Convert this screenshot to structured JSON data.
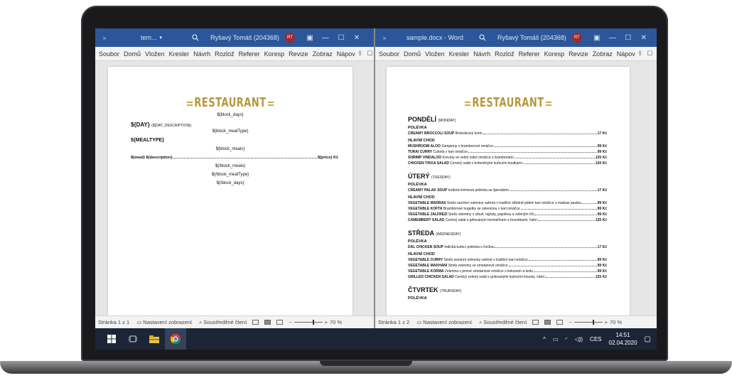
{
  "left": {
    "title": "tem...",
    "user": "Ryšavý Tomáš (204368)",
    "initials": "RT",
    "tabs": [
      "Soubor",
      "Domů",
      "Vložen",
      "Kresler",
      "Návrh",
      "Rozlož",
      "Referer",
      "Koresp",
      "Revize",
      "Zobraz",
      "Nápov"
    ],
    "logo": "RESTAURANT",
    "template": {
      "block_days": "${block_days}",
      "day": "${DAY}",
      "day_desc": "(${DAY_DESCRIPTION})",
      "block_mealtype": "${block_mealType}",
      "mealtype": "${MEALTYPE}",
      "block_meals": "${block_meals}",
      "meal_left": "${meal} ${description}",
      "meal_price": "${price} Kč",
      "end_meals": "${/block_meals}",
      "end_mealtype": "${/block_mealType}",
      "end_days": "${/block_days}"
    },
    "status": {
      "page": "Stránka 1 z 1",
      "view_settings": "Nastavení zobrazení",
      "focus": "Soustředěné čtení",
      "zoom": "70 %"
    }
  },
  "right": {
    "title": "sample.docx - Word",
    "user": "Ryšavý Tomáš (204368)",
    "initials": "RT",
    "tabs": [
      "Soubor",
      "Domů",
      "Vložen",
      "Kresler",
      "Návrh",
      "Rozlož",
      "Referer",
      "Koresp",
      "Revize",
      "Zobraz",
      "Nápov"
    ],
    "logo": "RESTAURANT",
    "days": [
      {
        "name": "PONDĚLÍ",
        "desc": "(MONDAY)",
        "sections": [
          {
            "title": "POLÉVKA",
            "rows": [
              {
                "name": "CREAMY BROCCOLI SOUP",
                "desc": "Brokolicový krém",
                "price": "17 Kč"
              }
            ]
          },
          {
            "title": "HLAVNÍ CHOD",
            "rows": [
              {
                "name": "MUSHROOM ALOO",
                "desc": "Žampiony v bramborové omáčce",
                "price": "99 Kč"
              },
              {
                "name": "TURAI CURRY",
                "desc": "Cuketa v kari omáčce",
                "price": "99 Kč"
              },
              {
                "name": "SHRIMP VINDALOO",
                "desc": "Krevety ve velmi ostré omáčce s bramborami",
                "price": "125 Kč"
              },
              {
                "name": "CHICKEN TIKKA SALAD",
                "desc": "Čerstvý salát s kořeněnými kuřecími kostkami",
                "price": "120 Kč"
              }
            ]
          }
        ]
      },
      {
        "name": "ÚTERÝ",
        "desc": "(TUESDAY)",
        "sections": [
          {
            "title": "POLÉVKA",
            "rows": [
              {
                "name": "CREAMY PALAK SOUP",
                "desc": "Indická krémová polévka se špenátem",
                "price": "17 Kč"
              }
            ]
          },
          {
            "title": "HLAVNÍ CHOD",
            "rows": [
              {
                "name": "VEGETABLE MADRAS",
                "desc": "Směs sezónní zeleniny vařená v tradiční středně pálivé kari omáčce s madras pastou",
                "price": "99 Kč"
              },
              {
                "name": "VEGETABLE KOFTA",
                "desc": "Bramborové nugetky se zeleninou v kari omáčce",
                "price": "99 Kč"
              },
              {
                "name": "VEGETABLE JALFREZI",
                "desc": "Směs zeleniny s cibulí, rajčaty, paprikou a zeleným čili",
                "price": "99 Kč"
              },
              {
                "name": "CAMEMBERT SALAD",
                "desc": "Čerstvý salát s grilovaným hermelínem s brusinkami, čatní",
                "price": "125 Kč"
              }
            ]
          }
        ]
      },
      {
        "name": "STŘEDA",
        "desc": "(WEDNESDAY)",
        "sections": [
          {
            "title": "POLÉVKA",
            "rows": [
              {
                "name": "DAL CHICKEN SOUP",
                "desc": "Indická kuřecí polévka s čočkou",
                "price": "17 Kč"
              }
            ]
          },
          {
            "title": "HLAVNÍ CHOD",
            "rows": [
              {
                "name": "VEGETABLE CURRY",
                "desc": "Směs sezónní zeleniny vařené v tradiční kari omáčce",
                "price": "99 Kč"
              },
              {
                "name": "VEGETABLE MAKHANI",
                "desc": "Směs zeleniny ve smetanové omáčce",
                "price": "99 Kč"
              },
              {
                "name": "VEGETABLE KORMA",
                "desc": "Zelenina v jemné smetanové omáčce s kokosem a kešu",
                "price": "99 Kč"
              },
              {
                "name": "GRILLED CHICKEN SALAD",
                "desc": "Čerstvý zelený salát s grilovanými kuřecími kousky, čatní",
                "price": "125 Kč"
              }
            ]
          }
        ]
      },
      {
        "name": "ČTVRTEK",
        "desc": "(THURSDAY)",
        "sections": [
          {
            "title": "POLÉVKA",
            "rows": []
          }
        ]
      }
    ],
    "status": {
      "page": "Stránka 1 z 2",
      "view_settings": "Nastavení zobrazení",
      "focus": "Soustředěné čtení",
      "zoom": "70 %"
    }
  },
  "taskbar": {
    "lang": "CES",
    "time": "14:51",
    "date": "02.04.2020"
  }
}
